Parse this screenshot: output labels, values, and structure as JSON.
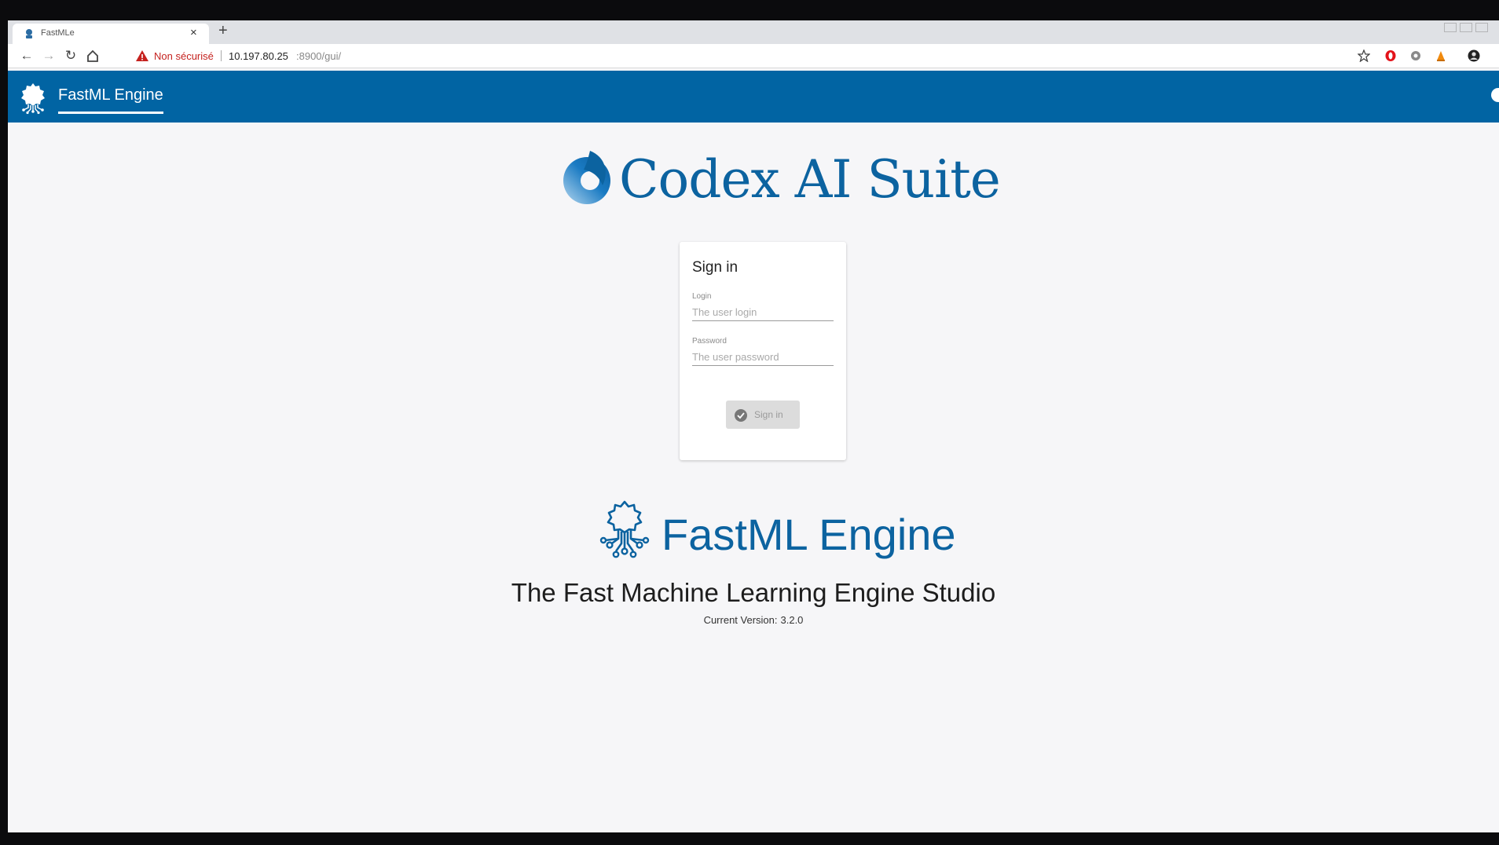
{
  "browser": {
    "tab_title": "FastMLe",
    "security_label": "Non sécurisé",
    "url_host": "10.197.80.25",
    "url_rest": ":8900/gui/"
  },
  "app_header": {
    "title": "FastML Engine"
  },
  "brand": {
    "suite_title": "Codex AI Suite"
  },
  "signin": {
    "title": "Sign in",
    "login_label": "Login",
    "login_placeholder": "The user login",
    "login_value": "",
    "password_label": "Password",
    "password_placeholder": "The user password",
    "password_value": "",
    "button_label": "Sign in"
  },
  "engine": {
    "title": "FastML Engine",
    "tagline": "The Fast Machine Learning Engine Studio",
    "version_label": "Current Version:",
    "version_number": "3.2.0"
  },
  "colors": {
    "header_blue": "#0164a3",
    "brand_blue": "#0c63a0",
    "page_background": "#f6f6f8",
    "security_red": "#c5221f"
  }
}
